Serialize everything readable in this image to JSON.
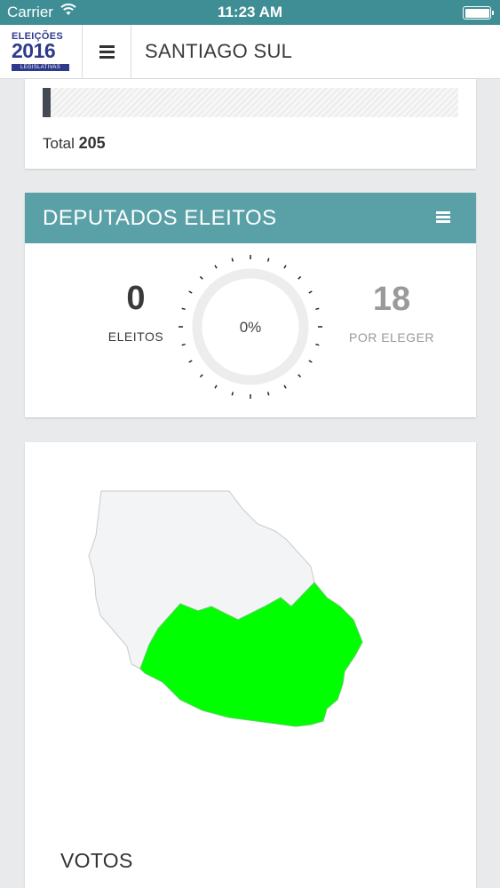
{
  "status": {
    "carrier": "Carrier",
    "time": "11:23 AM"
  },
  "nav": {
    "logo": {
      "line1": "ELEIÇÕES",
      "line2": "2016",
      "line3": "LEGISLATIVAS"
    },
    "title": "SANTIAGO SUL"
  },
  "results": {
    "total_label": "Total",
    "total_value": "205",
    "bar_progress": 0.02
  },
  "deputados": {
    "title": "DEPUTADOS ELEITOS",
    "elected_count": "0",
    "elected_label": "ELEITOS",
    "percent": "0%",
    "to_elect_count": "18",
    "to_elect_label": "POR ELEGER"
  },
  "map": {
    "section_title": "VOTOS",
    "highlight_color": "#00ff00",
    "base_color": "#f3f4f6"
  },
  "colors": {
    "status_bar": "#3f8e95",
    "card_header": "#5aa0a7"
  }
}
